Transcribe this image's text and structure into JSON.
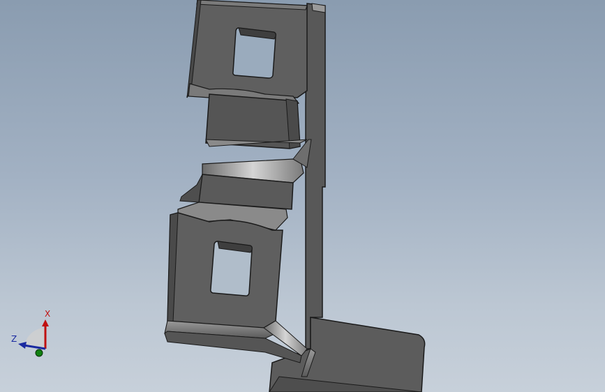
{
  "viewport": {
    "background_top": "#8a9cb0",
    "background_bottom": "#c7d0da"
  },
  "model": {
    "body_color": "#5f5f5f",
    "edge_color": "#1a1a1a",
    "highlight_color": "#bdbdbd",
    "hole_fill": "inherit-background"
  },
  "triad": {
    "x_label": "X",
    "z_label": "Z",
    "x_color": "#c01010",
    "z_color": "#1a2aa0",
    "y_color": "#108010"
  }
}
